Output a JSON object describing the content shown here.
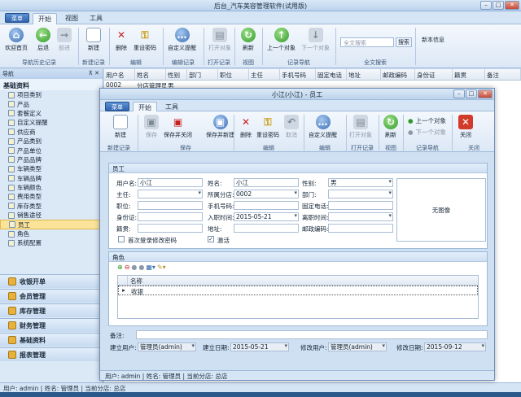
{
  "main_window": {
    "title": "后台_汽车美容管理软件(试用版)",
    "app_button": "菜单",
    "tabs": [
      "开始",
      "视图",
      "工具"
    ],
    "ribbon": {
      "buttons": [
        "欢迎首页",
        "后退",
        "前进",
        "新建",
        "删除",
        "重设密码",
        "自定义提醒",
        "打开对象",
        "刷新",
        "上一个对象",
        "下一个对象",
        "新本信息"
      ],
      "groups": [
        "导航历史记录",
        "新建记录",
        "编辑",
        "编辑记录",
        "打开记录",
        "视图",
        "记录导航",
        "全文搜索"
      ],
      "search_placeholder": "全文搜索",
      "search_button": "搜索"
    }
  },
  "nav": {
    "header": "导航",
    "group_title": "基础资料",
    "items": [
      "项目类别",
      "产品",
      "套餐定义",
      "自定义提醒",
      "供应商",
      "产品类别",
      "产品单位",
      "产品品牌",
      "车辆类型",
      "车辆品牌",
      "车辆颜色",
      "费用类型",
      "库存类型",
      "销售途径",
      "员工",
      "角色",
      "系统配置"
    ],
    "selected_item": "员工",
    "sections": [
      "收银开单",
      "会员管理",
      "库存管理",
      "财务管理",
      "基础资料",
      "报表管理"
    ]
  },
  "grid": {
    "columns": [
      "用户名",
      "姓名",
      "性别",
      "部门",
      "职位",
      "主任",
      "手机号码",
      "固定电话",
      "地址",
      "邮政编码",
      "身份证",
      "籍贯",
      "备注"
    ],
    "row": [
      "0002",
      "分店管理员",
      "男",
      "",
      "",
      "",
      "",
      "",
      "",
      "",
      "",
      "",
      ""
    ]
  },
  "status_bar": "用户: admin  |  姓名: 管理员  |  当前分店: 总店",
  "dialog": {
    "title": "小江(小江) - 员工",
    "app_button": "菜单",
    "tabs": [
      "开始",
      "工具"
    ],
    "ribbon": {
      "buttons": [
        "新建",
        "保存",
        "保存并关闭",
        "保存并新建",
        "删除",
        "重设密码",
        "取消",
        "自定义提醒",
        "打开对象",
        "刷新",
        "上一个对象",
        "下一个对象",
        "关闭"
      ],
      "groups": [
        "新建记录",
        "保存",
        "编辑",
        "编辑",
        "打开记录",
        "视图",
        "记录导航",
        "关闭"
      ]
    },
    "section_employee": "员工",
    "fields": {
      "username_label": "用户名:",
      "username": "小江",
      "name_label": "姓名:",
      "name": "小江",
      "gender_label": "性别:",
      "gender": "男",
      "supervisor_label": "主任:",
      "supervisor": "",
      "branch_label": "所属分店:",
      "branch": "0002",
      "dept_label": "部门:",
      "dept": "",
      "position_label": "职位:",
      "position": "",
      "mobile_label": "手机号码:",
      "mobile": "",
      "phone_label": "固定电话:",
      "phone": "",
      "idcard_label": "身份证:",
      "idcard": "",
      "hire_label": "入职时间:",
      "hire": "2015-05-21",
      "leave_label": "离职时间:",
      "leave": "",
      "origin_label": "籍贯:",
      "origin": "",
      "address_label": "地址:",
      "address": "",
      "postal_label": "邮政编码:",
      "postal": "",
      "first_login_label": "首次登录修改密码",
      "active_label": "激活"
    },
    "no_image": "无图像",
    "section_role": "角色",
    "role_columns": [
      "名称"
    ],
    "role_rows": [
      "收银"
    ],
    "remark_label": "备注:",
    "footer": {
      "created_user_label": "建立用户:",
      "created_user": "管理员(admin)",
      "created_date_label": "建立日期:",
      "created_date": "2015-05-21",
      "modified_user_label": "修改用户:",
      "modified_user": "管理员(admin)",
      "modified_date_label": "修改日期:",
      "modified_date": "2015-09-12"
    },
    "status_bar": "用户: admin  |  姓名: 管理员  |  当前分店: 总店"
  },
  "colors": {
    "accent": "#2f63ad",
    "selected": "#fbe39a",
    "panel": "#cfe0f3"
  }
}
